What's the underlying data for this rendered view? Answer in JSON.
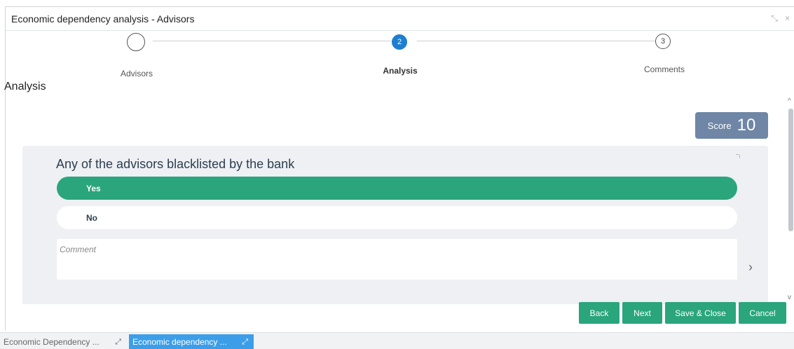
{
  "window": {
    "title": "Economic dependency analysis - Advisors",
    "icons": [
      "minimize-icon",
      "close-icon"
    ],
    "minimize_glyph": "⤡",
    "close_glyph": "×"
  },
  "stepper": {
    "steps": [
      {
        "label": "Advisors",
        "number": "",
        "state": "completed"
      },
      {
        "label": "Analysis",
        "number": "2",
        "state": "active"
      },
      {
        "label": "Comments",
        "number": "3",
        "state": "pending"
      }
    ],
    "active_color": "#1e7fd0"
  },
  "section_title": "Analysis",
  "score": {
    "label": "Score",
    "value": "10",
    "color": "#6f86a6"
  },
  "question": {
    "text": "Any of the advisors blacklisted by the bank",
    "options": [
      {
        "label": "Yes",
        "selected": true
      },
      {
        "label": "No",
        "selected": false
      }
    ],
    "selected_color": "#2aa57c",
    "comment_placeholder": "Comment",
    "chevron_glyph": "›"
  },
  "scrollbar": {
    "up_glyph": "^",
    "down_glyph": "v"
  },
  "buttons": [
    {
      "label": "Back"
    },
    {
      "label": "Next"
    },
    {
      "label": "Save & Close"
    },
    {
      "label": "Cancel"
    }
  ],
  "taskbar": {
    "tasks": [
      {
        "label": "Economic Dependency ...",
        "active": false,
        "icon": "expand-icon"
      },
      {
        "label": "Economic dependency ...",
        "active": true,
        "icon": "expand-icon"
      }
    ],
    "expand_glyph": "⤢"
  }
}
